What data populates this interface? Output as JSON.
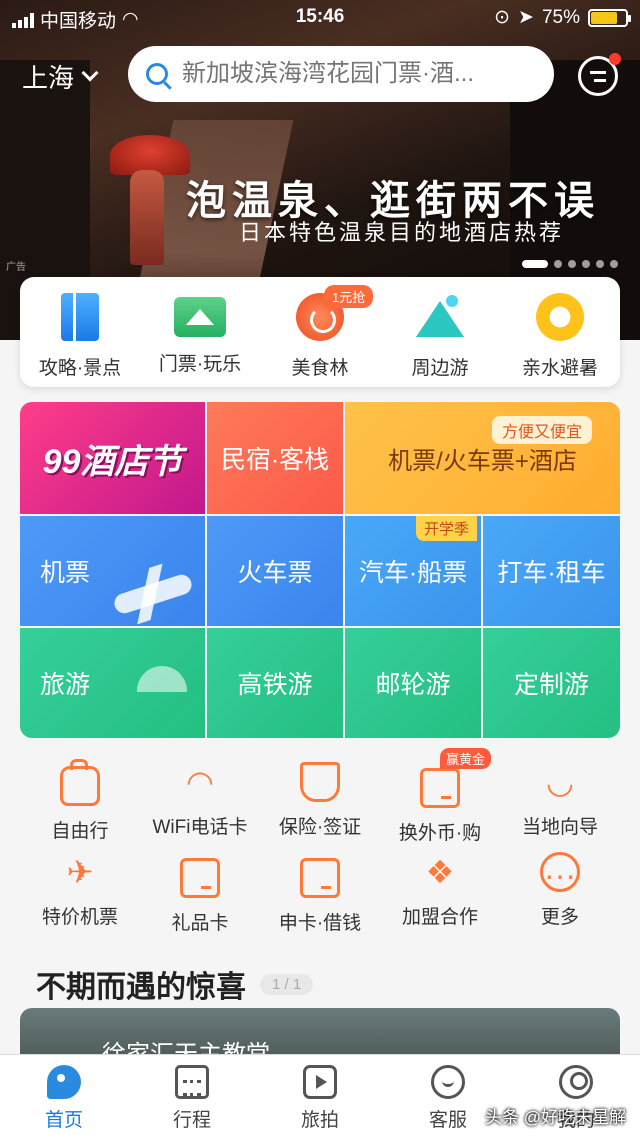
{
  "status": {
    "carrier": "中国移动",
    "time": "15:46",
    "battery": "75%",
    "battery_level": 0.75
  },
  "header": {
    "city": "上海",
    "search_placeholder": "新加坡滨海湾花园门票·酒..."
  },
  "banner": {
    "title": "泡温泉、逛街两不误",
    "subtitle": "日本特色温泉目的地酒店热荐",
    "ad_tag": "广告"
  },
  "categories": [
    {
      "label": "攻略·景点",
      "icon": "guide-book-icon"
    },
    {
      "label": "门票·玩乐",
      "icon": "ticket-icon"
    },
    {
      "label": "美食林",
      "icon": "food-icon",
      "badge": "1元抢"
    },
    {
      "label": "周边游",
      "icon": "mountain-icon"
    },
    {
      "label": "亲水避暑",
      "icon": "swim-ring-icon"
    }
  ],
  "grid": {
    "hotel99": "99酒店节",
    "minsu": "民宿·客栈",
    "combo": "机票/火车票+酒店",
    "combo_tag": "方便又便宜",
    "flight": "机票",
    "train": "火车票",
    "bus": "汽车·船票",
    "bus_tag": "开学季",
    "taxi": "打车·租车",
    "travel": "旅游",
    "hsr": "高铁游",
    "cruise": "邮轮游",
    "custom": "定制游"
  },
  "services_row1": [
    {
      "label": "自由行",
      "icon": "backpack-icon"
    },
    {
      "label": "WiFi电话卡",
      "icon": "wifi-icon"
    },
    {
      "label": "保险·签证",
      "icon": "shield-icon"
    },
    {
      "label": "换外币·购",
      "icon": "currency-icon",
      "badge": "赢黄金"
    },
    {
      "label": "当地向导",
      "icon": "lips-icon"
    }
  ],
  "services_row2": [
    {
      "label": "特价机票",
      "icon": "plane-icon"
    },
    {
      "label": "礼品卡",
      "icon": "gift-card-icon"
    },
    {
      "label": "申卡·借钱",
      "icon": "credit-card-icon"
    },
    {
      "label": "加盟合作",
      "icon": "handshake-icon"
    },
    {
      "label": "更多",
      "icon": "more-icon"
    }
  ],
  "section": {
    "title": "不期而遇的惊喜",
    "pager": "1 / 1",
    "promo_title": "徐家汇天主教堂"
  },
  "tabs": [
    {
      "label": "首页",
      "icon": "home-dolphin-icon",
      "active": true
    },
    {
      "label": "行程",
      "icon": "calendar-icon"
    },
    {
      "label": "旅拍",
      "icon": "video-icon"
    },
    {
      "label": "客服",
      "icon": "headset-icon"
    },
    {
      "label": "我的",
      "icon": "user-icon"
    }
  ],
  "watermark": "头条 @好吃未星解"
}
